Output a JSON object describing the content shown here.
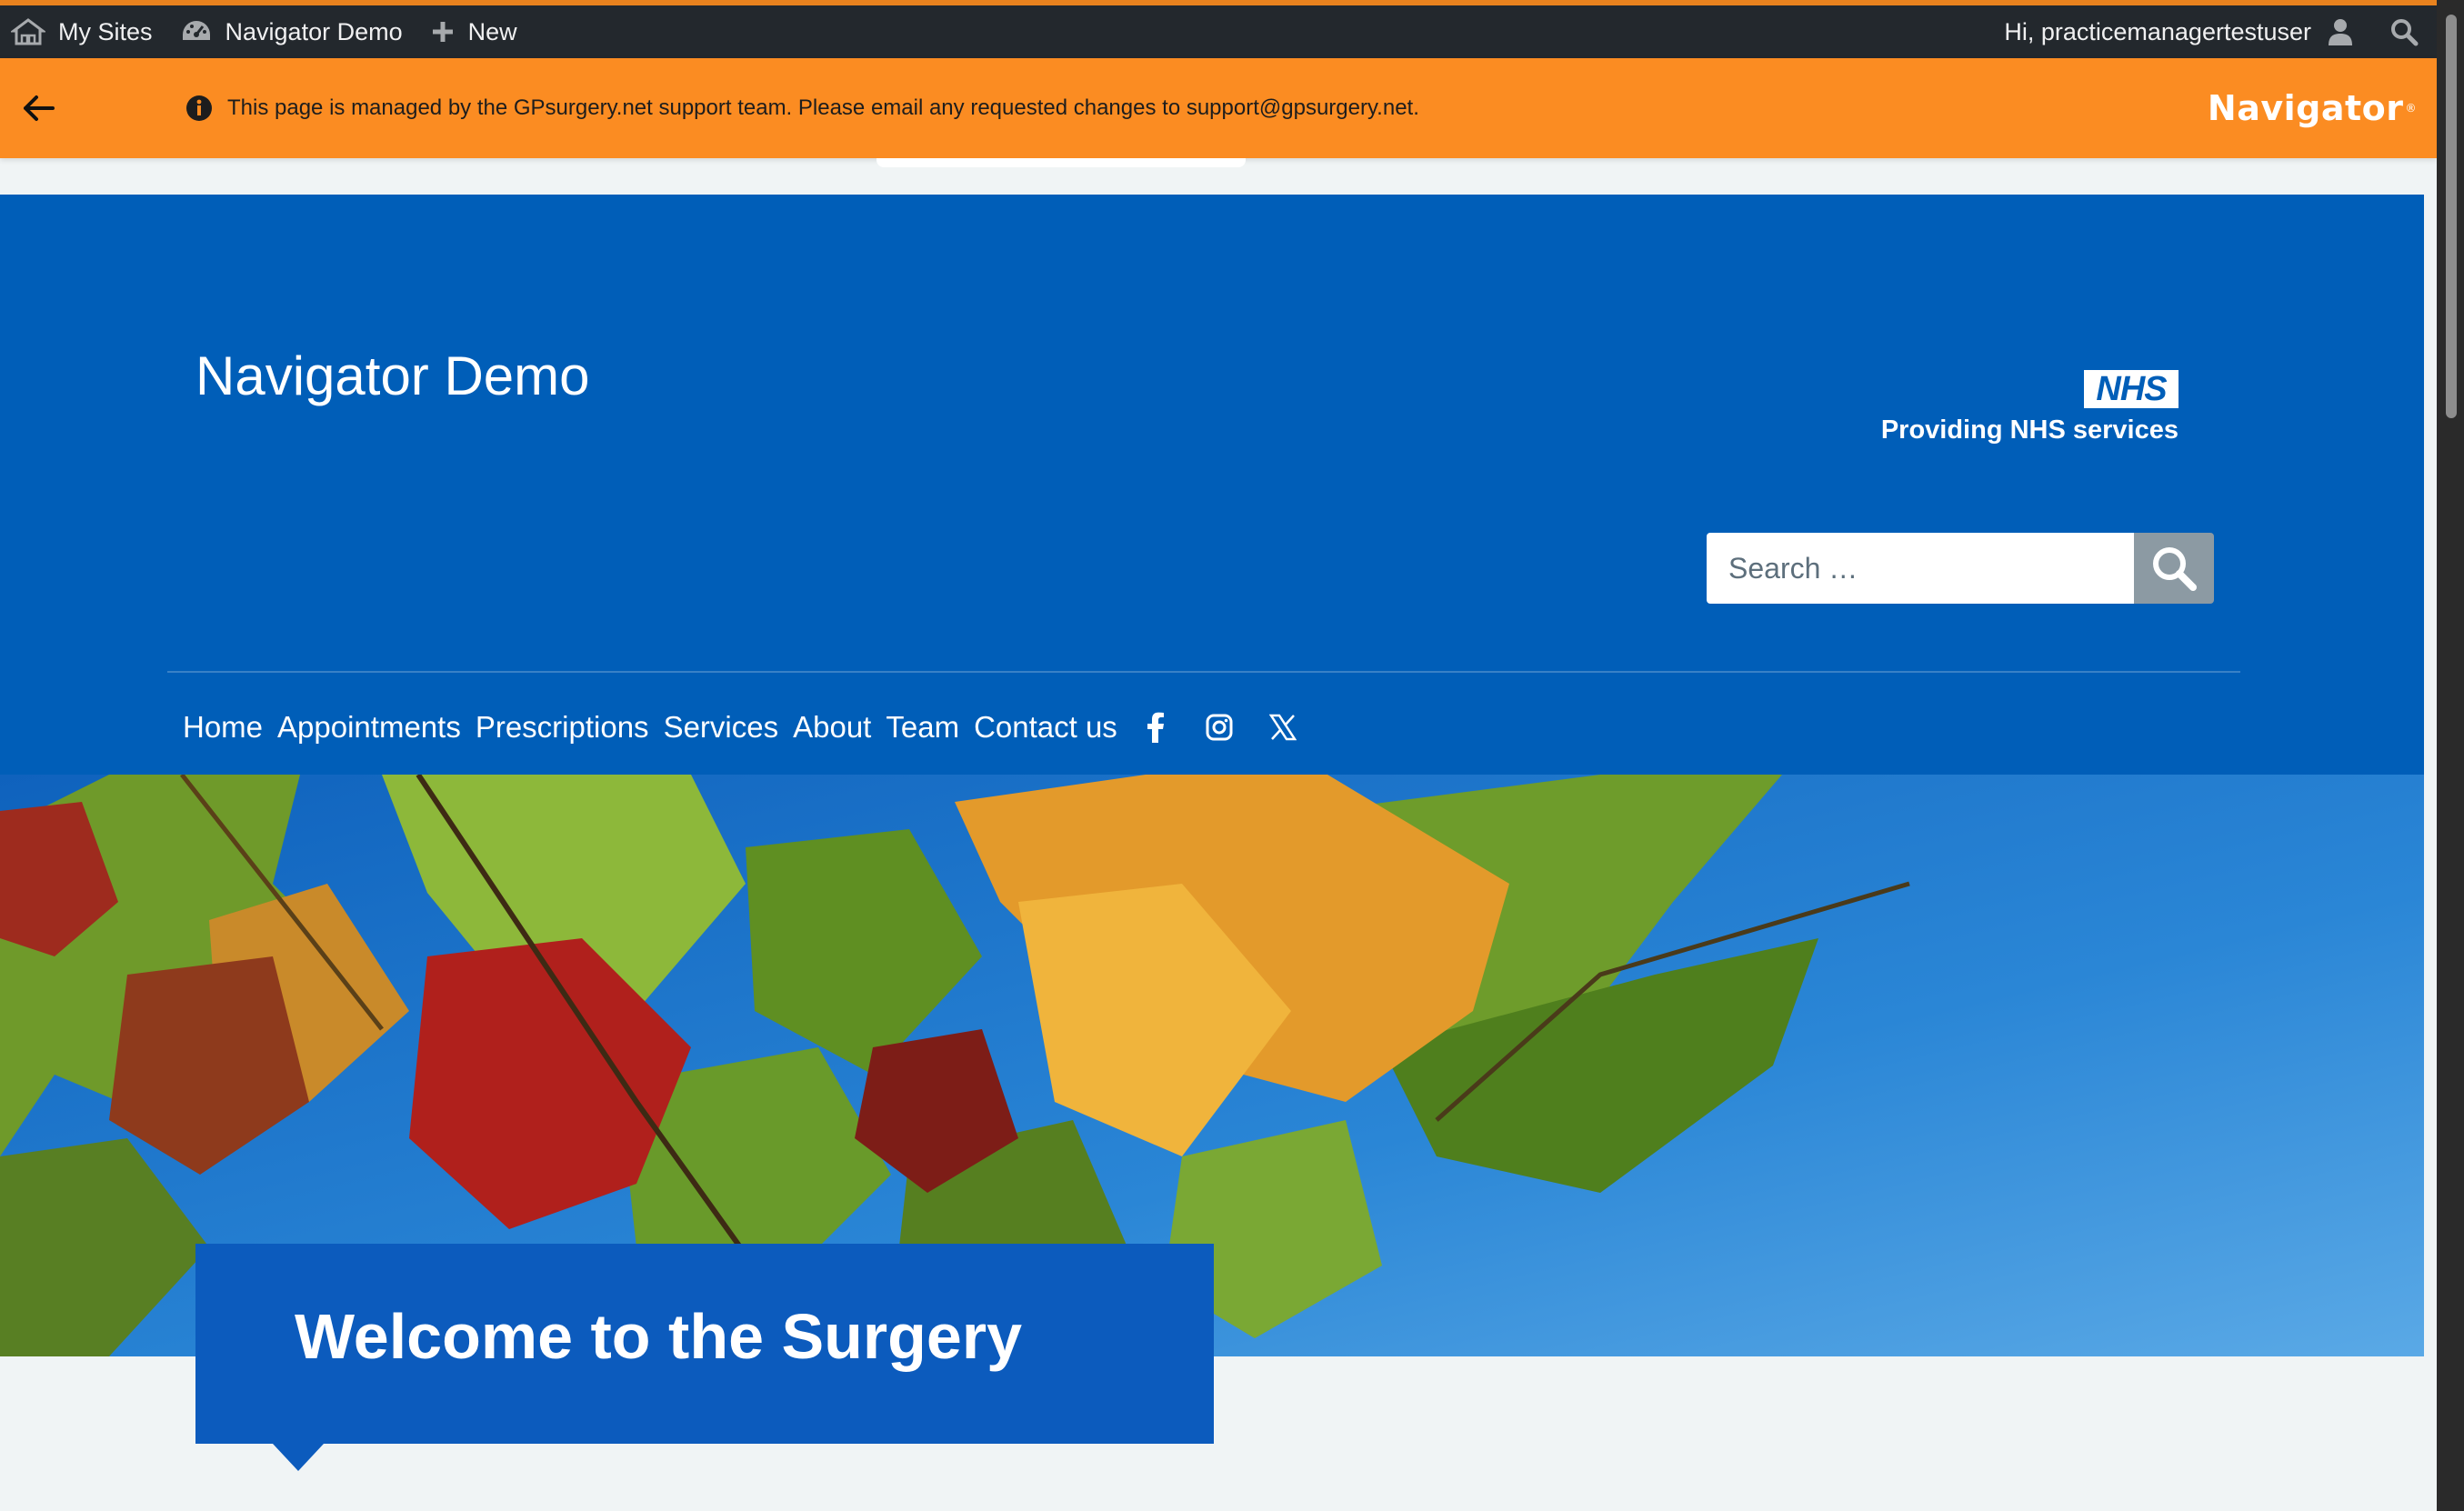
{
  "admin_bar": {
    "my_sites": "My Sites",
    "site_name": "Navigator Demo",
    "new_label": "New",
    "greeting": "Hi, practicemanagertestuser"
  },
  "notice": {
    "text": "This page is managed by the GPsurgery.net support team. Please email any requested changes to support@gpsurgery.net.",
    "brand": "Navigator"
  },
  "header": {
    "site_title": "Navigator Demo",
    "nhs_logo_text": "NHS",
    "nhs_subtitle": "Providing NHS services",
    "search_placeholder": "Search …"
  },
  "nav": {
    "items": [
      "Home",
      "Appointments",
      "Prescriptions",
      "Services",
      "About",
      "Team",
      "Contact us"
    ]
  },
  "hero": {
    "heading": "Welcome to the Surgery"
  },
  "colors": {
    "admin_bar": "#23282d",
    "notice_bar": "#fb8c22",
    "nhs_blue": "#005eb8",
    "welcome_box": "#0c5bbd",
    "page_bg": "#f0f4f5"
  },
  "icons": {
    "admin": [
      "my-sites-icon",
      "dashboard-icon",
      "plus-icon",
      "user-avatar-icon",
      "search-icon"
    ],
    "notice": [
      "back-arrow-icon",
      "info-icon"
    ],
    "social": [
      "facebook-icon",
      "instagram-icon",
      "x-twitter-icon"
    ],
    "search": "magnifier-icon"
  }
}
